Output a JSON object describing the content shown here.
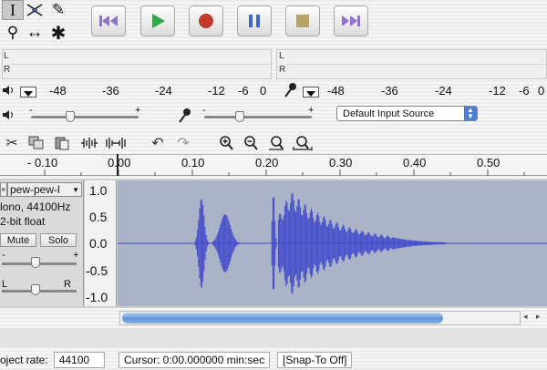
{
  "tools": {
    "selection_glyph": "I",
    "draw_glyph": "✎",
    "zoom_glyph": "⚲",
    "timeshift_glyph": "↔",
    "multi_glyph": "✱"
  },
  "meters": {
    "left_channel": "L",
    "right_channel": "R",
    "playback_scale": [
      "-48",
      "-36",
      "-24",
      "-12",
      "-6",
      "0"
    ],
    "record_scale": [
      "-48",
      "-36",
      "-24",
      "-12",
      "-6",
      "0"
    ]
  },
  "mixer": {
    "slider_min": "-",
    "slider_max": "+",
    "input_source": "Default Input Source"
  },
  "ruler": {
    "labels": [
      "- 0.10",
      "0.00",
      "0.10",
      "0.20",
      "0.30",
      "0.40",
      "0.50"
    ]
  },
  "track": {
    "name": "pew-pew-l",
    "info_line1": "lono, 44100Hz",
    "info_line2": "2-bit float",
    "mute_label": "Mute",
    "solo_label": "Solo",
    "pan_left": "L",
    "pan_right": "R",
    "y_ticks": [
      "1.0",
      "0.5",
      "0.0",
      "-0.5",
      "-1.0"
    ],
    "waveform_color": "#3f48cc",
    "background_color": "#aab4c6"
  },
  "statusbar": {
    "rate_label": "oject rate:",
    "rate_value": "44100",
    "cursor_text": "Cursor: 0:00.000000 min:sec",
    "snap_text": "[Snap-To Off]"
  },
  "colors": {
    "play_green": "#2fa84a",
    "record_red": "#c0392b",
    "pause_blue": "#3a67c9",
    "stop_olive": "#b5a46a",
    "skip_purple": "#8f73c9"
  }
}
